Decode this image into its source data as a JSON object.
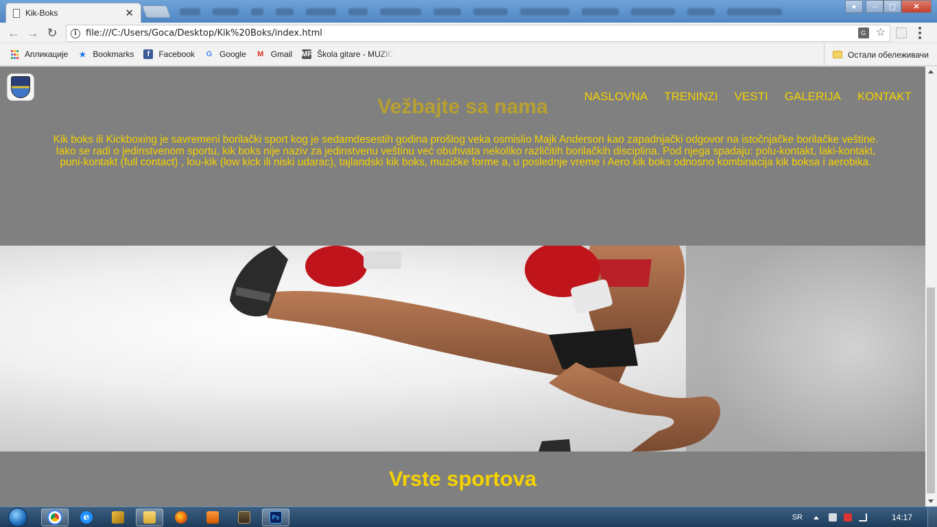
{
  "browser": {
    "tab_title": "Kik-Boks",
    "tab_close": "✕",
    "url": "file:///C:/Users/Goca/Desktop/Kik%20Boks/index.html",
    "bookmarks": [
      {
        "label": "Апликације",
        "icon": "apps-icon"
      },
      {
        "label": "Bookmarks",
        "icon": "star-icon"
      },
      {
        "label": "Facebook",
        "icon": "facebook-icon"
      },
      {
        "label": "Google",
        "icon": "google-icon"
      },
      {
        "label": "Gmail",
        "icon": "gmail-icon"
      },
      {
        "label": "Škola gitare - MUZIC",
        "icon": "mf-icon"
      }
    ],
    "other_bookmarks": "Остали обележивачи"
  },
  "page": {
    "nav": [
      "NASLOVNA",
      "TRENINZI",
      "VESTI",
      "GALERIJA",
      "KONTAKT"
    ],
    "hero_title": "Vežbajte sa nama",
    "hero_text": "Kik boks ili Kickboxing je savremeni borilački sport kog je sedamdesestih godina prošlog veka osmislio Majk Anderson kao zapadnjački odgovor na istočnjačke borilačke veštine. Iako se radi o jedinstvenom sportu, kik boks nije naziv za jedinstvenu veštinu već obuhvata nekoliko različitih borilačkih disciplina. Pod njega spadaju: polu-kontakt, laki-kontakt, puni-kontakt (full contact) , lou-kik (low kick ili niski udarac), tajlandski kik boks, muzičke forme a, u poslednje vreme i Aero kik boks odnosno kombinacija kik boksa i aerobika.",
    "section_title": "Vrste sportova",
    "colors": {
      "accent": "#f5d200",
      "background": "#808080",
      "title_dim": "#b8a030"
    }
  },
  "taskbar": {
    "lang": "SR",
    "clock": "14:17"
  }
}
